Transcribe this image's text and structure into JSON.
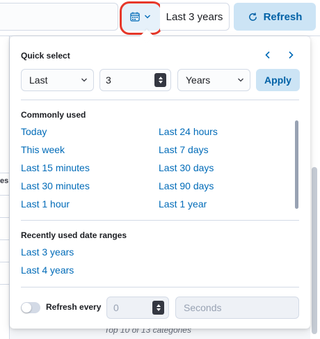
{
  "toolbar": {
    "range_label": "Last 3 years",
    "refresh_label": "Refresh",
    "calendar_icon": "calendar-icon",
    "chevron_icon": "chevron-down-icon",
    "refresh_icon": "refresh-icon"
  },
  "background": {
    "left_fragment": "es",
    "footer_text": "Top 10 of 13 categories"
  },
  "quick_select": {
    "title": "Quick select",
    "tense": "Last",
    "value": "3",
    "unit": "Years",
    "apply_label": "Apply"
  },
  "commonly_used": {
    "title": "Commonly used",
    "left": [
      "Today",
      "This week",
      "Last 15 minutes",
      "Last 30 minutes",
      "Last 1 hour"
    ],
    "right": [
      "Last 24 hours",
      "Last 7 days",
      "Last 30 days",
      "Last 90 days",
      "Last 1 year"
    ]
  },
  "recent": {
    "title": "Recently used date ranges",
    "items": [
      "Last 3 years",
      "Last 4 years"
    ]
  },
  "auto_refresh": {
    "label": "Refresh every",
    "interval": "0",
    "unit_placeholder": "Seconds",
    "enabled": false
  },
  "colors": {
    "accent": "#006bb8",
    "highlight_ring": "#e7382a",
    "primary_button_bg": "#cce4f5"
  }
}
